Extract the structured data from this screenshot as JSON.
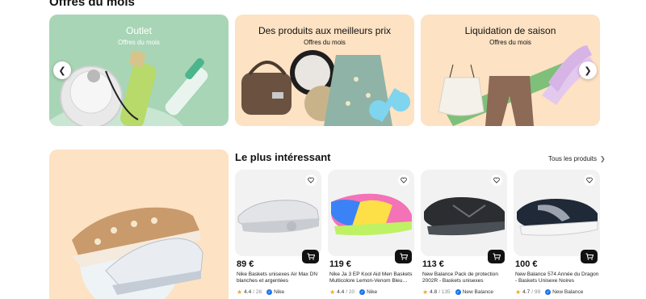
{
  "section": {
    "title": "Offres du mois"
  },
  "promos": [
    {
      "title": "Outlet",
      "subtitle": "Offres du mois",
      "bg": "#a8d5b6"
    },
    {
      "title": "Des produits aux meilleurs prix",
      "subtitle": "Offres du mois",
      "bg": "#fde2c3"
    },
    {
      "title": "Liquidation de saison",
      "subtitle": "Offres du mois",
      "bg": "#fde2c3"
    }
  ],
  "carousel": {
    "prev_icon": "chevron-left-icon",
    "next_icon": "chevron-right-icon"
  },
  "recommendations": {
    "title": "Le plus intéressant",
    "see_all": "Tous les produits"
  },
  "products": [
    {
      "price": "89 €",
      "title": "Nike Baskets unisexes Air Max DN blanches et argentées métallisées…",
      "rating": "4.4",
      "reviews": "/ 28",
      "brand": "Nike"
    },
    {
      "price": "119 €",
      "title": "Nike Ja 3 EP Kool Aid Men Baskets Multicolore Lemon-Venom Bleu…",
      "rating": "4.4",
      "reviews": "/ 20",
      "brand": "Nike"
    },
    {
      "price": "113 €",
      "title": "New Balance Pack de protection 2002R - Baskets unisexes Phantom…",
      "rating": "4.8",
      "reviews": "/ 135",
      "brand": "New Balance"
    },
    {
      "price": "100 €",
      "title": "New Balance 574 Année du Dragon - Baskets Unisexe Noires Blanches…",
      "rating": "4.7",
      "reviews": "/ 99",
      "brand": "New Balance"
    }
  ]
}
